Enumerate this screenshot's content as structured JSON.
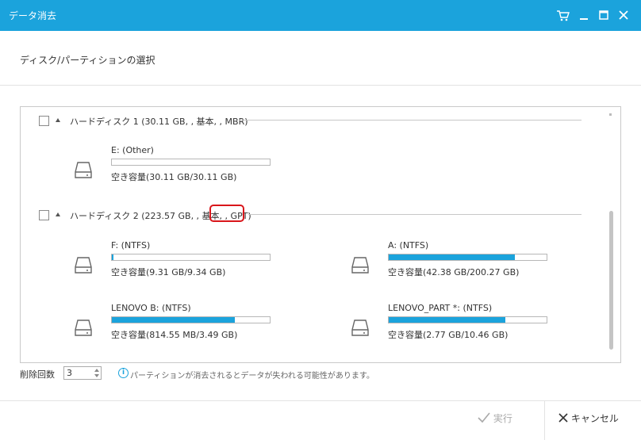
{
  "window": {
    "title": "データ消去"
  },
  "section_title": "ディスク/パーティションの選択",
  "disks": [
    {
      "label": "ハードディスク 1 (30.11 GB, , 基本, , MBR)",
      "partitions": [
        {
          "name": "E: (Other)",
          "free": "空き容量(30.11 GB/30.11 GB)",
          "used_fraction": 0.0
        }
      ]
    },
    {
      "label": "ハードディスク 2 (223.57 GB, , 基本, , GPT)",
      "partitions": [
        {
          "name": "F: (NTFS)",
          "free": "空き容量(9.31 GB/9.34 GB)",
          "used_fraction": 0.01
        },
        {
          "name": "A: (NTFS)",
          "free": "空き容量(42.38 GB/200.27 GB)",
          "used_fraction": 0.8
        },
        {
          "name": "LENOVO B: (NTFS)",
          "free": "空き容量(814.55 MB/3.49 GB)",
          "used_fraction": 0.78
        },
        {
          "name": "LENOVO_PART *: (NTFS)",
          "free": "空き容量(2.77 GB/10.46 GB)",
          "used_fraction": 0.74
        }
      ]
    }
  ],
  "delete_count": {
    "label": "削除回数",
    "value": "3"
  },
  "info_text": "パーティションが消去されるとデータが失われる可能性があります。",
  "buttons": {
    "execute": "実行",
    "cancel": "キャンセル"
  },
  "icons": [
    "cart-icon",
    "minimize-icon",
    "maximize-icon",
    "close-icon",
    "drive-icon",
    "info-icon",
    "check-icon",
    "x-icon"
  ],
  "colors": {
    "accent": "#1ba3dc",
    "highlight": "#d9161b"
  }
}
